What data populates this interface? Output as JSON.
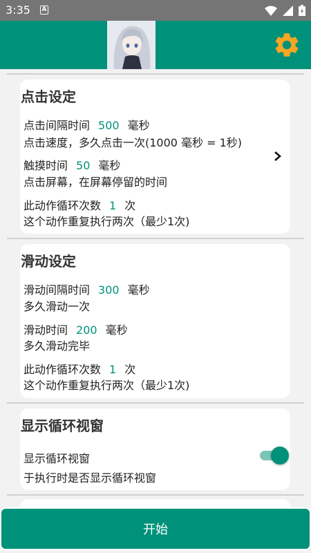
{
  "status_bar": {
    "time": "3:35",
    "notification_letter": "A"
  },
  "header": {
    "settings_icon": "gear-icon",
    "avatar_icon": "anime-girl-avatar"
  },
  "click_settings": {
    "title": "点击设定",
    "interval_label": "点击间隔时间",
    "interval_value": "500",
    "interval_unit": "毫秒",
    "interval_desc": "点击速度，多久点击一次(1000 毫秒 = 1秒)",
    "touch_label": "触摸时间",
    "touch_value": "50",
    "touch_unit": "毫秒",
    "touch_desc": "点击屏幕，在屏幕停留的时间",
    "loop_label": "此动作循环次数",
    "loop_value": "1",
    "loop_unit": "次",
    "loop_desc": "这个动作重复执行两次（最少1次)"
  },
  "swipe_settings": {
    "title": "滑动设定",
    "interval_label": "滑动间隔时间",
    "interval_value": "300",
    "interval_unit": "毫秒",
    "interval_desc": "多久滑动一次",
    "duration_label": "滑动时间",
    "duration_value": "200",
    "duration_unit": "毫秒",
    "duration_desc": "多久滑动完毕",
    "loop_label": "此动作循环次数",
    "loop_value": "1",
    "loop_unit": "次",
    "loop_desc": "这个动作重复执行两次（最少1次)"
  },
  "loop_window": {
    "title": "显示循环视窗",
    "toggle_label": "显示循环视窗",
    "toggle_desc": "于执行时是否显示循环视窗",
    "toggle_on": true
  },
  "start_button": {
    "label": "开始"
  },
  "colors": {
    "accent": "#00917a",
    "status_bar": "#757575",
    "toggle_track": "#7cc4b8"
  }
}
